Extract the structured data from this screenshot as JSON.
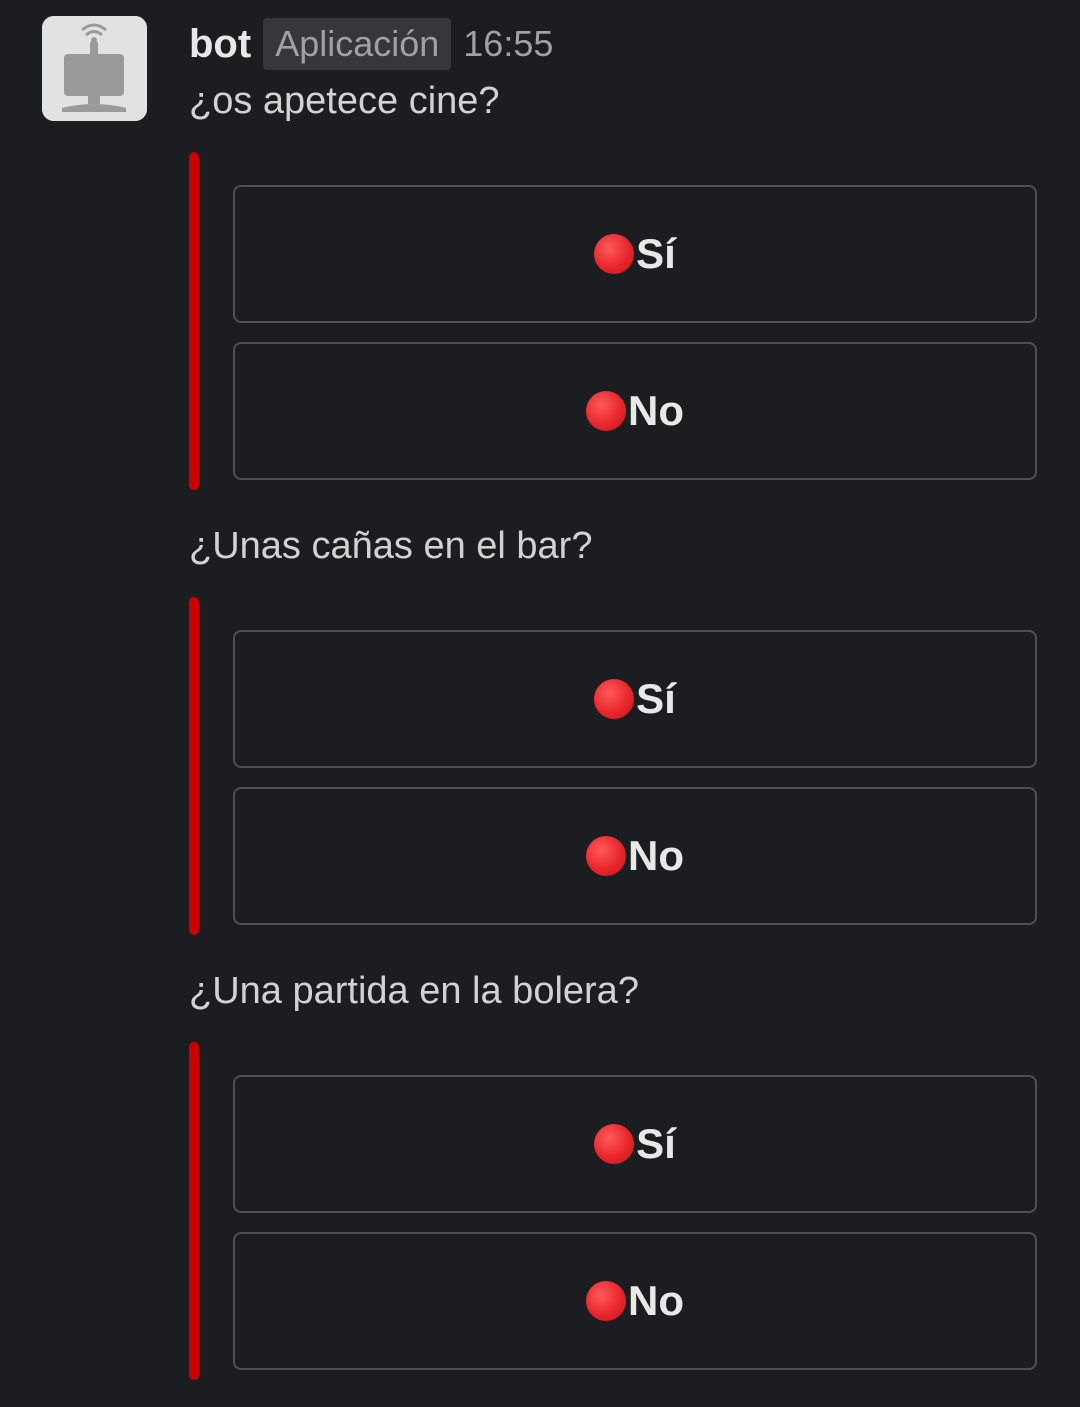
{
  "message": {
    "author": "bot",
    "badge": "Aplicación",
    "time": "16:55",
    "avatar_icon": "robot-avatar-icon"
  },
  "polls": [
    {
      "question": "¿os apetece cine?",
      "accent_color": "#cc0000",
      "options": [
        {
          "icon": "red-circle-icon",
          "label": "Sí"
        },
        {
          "icon": "red-circle-icon",
          "label": "No"
        }
      ]
    },
    {
      "question": "¿Unas cañas en el bar?",
      "accent_color": "#cc0000",
      "options": [
        {
          "icon": "red-circle-icon",
          "label": "Sí"
        },
        {
          "icon": "red-circle-icon",
          "label": "No"
        }
      ]
    },
    {
      "question": "¿Una partida en la bolera?",
      "accent_color": "#cc0000",
      "options": [
        {
          "icon": "red-circle-icon",
          "label": "Sí"
        },
        {
          "icon": "red-circle-icon",
          "label": "No"
        }
      ]
    }
  ]
}
